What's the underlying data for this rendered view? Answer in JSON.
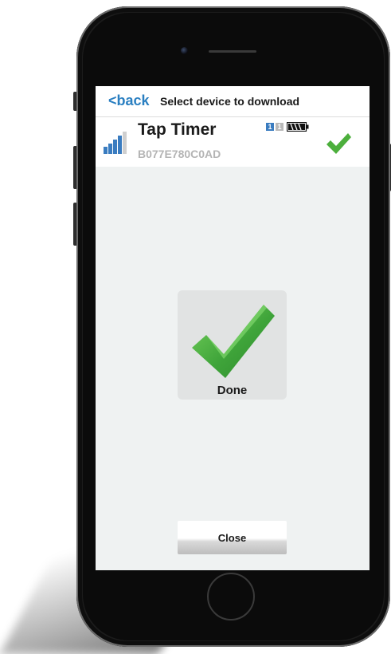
{
  "header": {
    "back_label": "<back",
    "title": "Select device to download"
  },
  "device": {
    "name": "Tap Timer",
    "id": "B077E780C0AD",
    "badges": [
      "1",
      "1"
    ],
    "badge_colors": [
      "#3a7cc0",
      "#b9b9b9"
    ],
    "signal_icon": "signal-strength-icon",
    "battery_icon": "battery-icon",
    "status_icon": "checkmark-icon",
    "status_color": "#4caf3c"
  },
  "status": {
    "label": "Done",
    "icon": "checkmark-icon",
    "color": "#4caf3c"
  },
  "actions": {
    "close_label": "Close"
  },
  "colors": {
    "accent": "#2a7fc1",
    "screen_bg": "#eff2f2"
  }
}
